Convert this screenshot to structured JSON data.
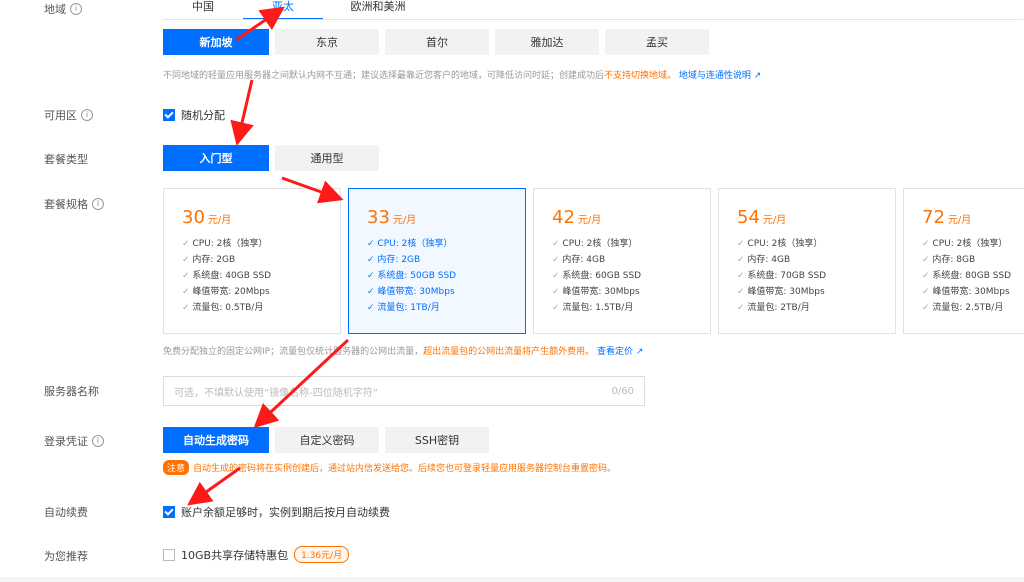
{
  "region": {
    "label": "地域",
    "tabs": [
      "中国",
      "亚太",
      "欧洲和美洲"
    ],
    "options": [
      "新加坡",
      "东京",
      "首尔",
      "雅加达",
      "孟买"
    ],
    "hint_text": "不同地域的轻量应用服务器之间默认内网不互通；建议选择最靠近您客户的地域，可降低访问时延；创建成功后",
    "hint_warn": "不支持切换地域。",
    "hint_link": "地域与连通性说明"
  },
  "zone": {
    "label": "可用区",
    "option": "随机分配"
  },
  "plan_type": {
    "label": "套餐类型",
    "options": [
      "入门型",
      "通用型"
    ]
  },
  "plan_spec": {
    "label": "套餐规格",
    "unit": "元/月",
    "cards": [
      {
        "price": "30",
        "specs": [
          "CPU: 2核（独享）",
          "内存: 2GB",
          "系统盘: 40GB SSD",
          "峰值带宽: 20Mbps",
          "流量包: 0.5TB/月"
        ]
      },
      {
        "price": "33",
        "specs": [
          "CPU: 2核（独享）",
          "内存: 2GB",
          "系统盘: 50GB SSD",
          "峰值带宽: 30Mbps",
          "流量包: 1TB/月"
        ]
      },
      {
        "price": "42",
        "specs": [
          "CPU: 2核（独享）",
          "内存: 4GB",
          "系统盘: 60GB SSD",
          "峰值带宽: 30Mbps",
          "流量包: 1.5TB/月"
        ]
      },
      {
        "price": "54",
        "specs": [
          "CPU: 2核（独享）",
          "内存: 4GB",
          "系统盘: 70GB SSD",
          "峰值带宽: 30Mbps",
          "流量包: 2TB/月"
        ]
      },
      {
        "price": "72",
        "specs": [
          "CPU: 2核（独享）",
          "内存: 8GB",
          "系统盘: 80GB SSD",
          "峰值带宽: 30Mbps",
          "流量包: 2.5TB/月"
        ]
      }
    ],
    "hint_text": "免费分配独立的固定公网IP；流量包仅统计服务器的公网出流量，",
    "hint_warn": "超出流量包的公网出流量将产生额外费用。",
    "hint_link": "查看定价"
  },
  "server_name": {
    "label": "服务器名称",
    "placeholder": "可选，不填默认使用“镜像名称-四位随机字符”",
    "counter": "0/60"
  },
  "login": {
    "label": "登录凭证",
    "options": [
      "自动生成密码",
      "自定义密码",
      "SSH密钥"
    ],
    "notice_badge": "注意",
    "notice_text": "自动生成的密码将在实例创建后，通过站内信发送给您。后续您也可登录轻量应用服务器控制台重置密码。"
  },
  "auto_renew": {
    "label": "自动续费",
    "option": "账户余额足够时，实例到期后按月自动续费"
  },
  "recommend": {
    "label": "为您推荐",
    "option": "10GB共享存储特惠包",
    "price_badge": "1.36元/月"
  },
  "colors": {
    "primary": "#006eff",
    "warning": "#ff7200",
    "annotation_arrow": "#ff0000"
  }
}
